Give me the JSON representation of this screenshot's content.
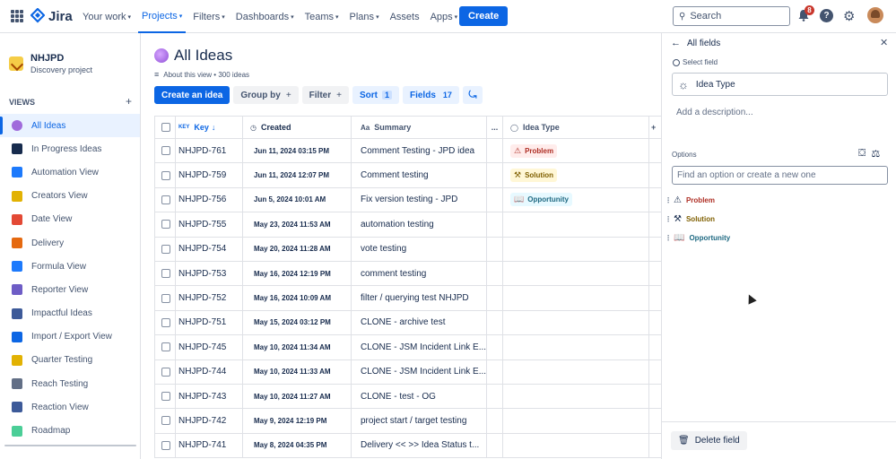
{
  "topnav": {
    "logo": "Jira",
    "items": [
      {
        "label": "Your work"
      },
      {
        "label": "Projects",
        "active": true
      },
      {
        "label": "Filters"
      },
      {
        "label": "Dashboards"
      },
      {
        "label": "Teams"
      },
      {
        "label": "Plans"
      },
      {
        "label": "Assets"
      },
      {
        "label": "Apps"
      }
    ],
    "create_label": "Create",
    "search_placeholder": "Search",
    "notifications_count": "8"
  },
  "sidebar": {
    "project_name": "NHJPD",
    "project_type": "Discovery project",
    "views_heading": "VIEWS",
    "views": [
      {
        "label": "All Ideas",
        "icon": "idea-globe-icon",
        "color": "#a06bdb"
      },
      {
        "label": "In Progress Ideas",
        "icon": "soon-icon",
        "color": "#172b4d"
      },
      {
        "label": "Automation View",
        "icon": "loop-icon",
        "color": "#1d7afc"
      },
      {
        "label": "Creators View",
        "icon": "creator-icon",
        "color": "#e2b203"
      },
      {
        "label": "Date View",
        "icon": "calendar-icon",
        "color": "#e34935"
      },
      {
        "label": "Delivery",
        "icon": "truck-icon",
        "color": "#e56910"
      },
      {
        "label": "Formula View",
        "icon": "formula-icon",
        "color": "#1d7afc"
      },
      {
        "label": "Reporter View",
        "icon": "pen-icon",
        "color": "#6e5dc6"
      },
      {
        "label": "Impactful Ideas",
        "icon": "bar-chart-icon",
        "color": "#3d5a99"
      },
      {
        "label": "Import / Export View",
        "icon": "arrows-icon",
        "color": "#0c66e4"
      },
      {
        "label": "Quarter Testing",
        "icon": "runner-icon",
        "color": "#e2b203"
      },
      {
        "label": "Reach Testing",
        "icon": "reach-icon",
        "color": "#626f86"
      },
      {
        "label": "Reaction View",
        "icon": "reaction-icon",
        "color": "#3d5a99"
      },
      {
        "label": "Roadmap",
        "icon": "map-icon",
        "color": "#4bce97"
      }
    ]
  },
  "main": {
    "title": "All Ideas",
    "about": "About this view",
    "ideas_count": "300 ideas",
    "toolbar": {
      "create_idea": "Create an idea",
      "group_by": "Group by",
      "filter": "Filter",
      "sort": "Sort",
      "sort_count": "1",
      "fields": "Fields",
      "fields_count": "17"
    },
    "columns": {
      "key": "Key",
      "created": "Created",
      "summary": "Summary",
      "dots": "...",
      "type": "Idea Type"
    },
    "rows": [
      {
        "key": "NHJPD-761",
        "created": "Jun 11, 2024 03:15 PM",
        "summary": "Comment Testing - JPD idea",
        "type": "Problem"
      },
      {
        "key": "NHJPD-759",
        "created": "Jun 11, 2024 12:07 PM",
        "summary": "Comment testing",
        "type": "Solution"
      },
      {
        "key": "NHJPD-756",
        "created": "Jun 5, 2024 10:01 AM",
        "summary": "Fix version testing - JPD",
        "type": "Opportunity"
      },
      {
        "key": "NHJPD-755",
        "created": "May 23, 2024 11:53 AM",
        "summary": "automation testing",
        "type": ""
      },
      {
        "key": "NHJPD-754",
        "created": "May 20, 2024 11:28 AM",
        "summary": "vote testing",
        "type": ""
      },
      {
        "key": "NHJPD-753",
        "created": "May 16, 2024 12:19 PM",
        "summary": "comment testing",
        "type": ""
      },
      {
        "key": "NHJPD-752",
        "created": "May 16, 2024 10:09 AM",
        "summary": "filter / querying test NHJPD",
        "type": ""
      },
      {
        "key": "NHJPD-751",
        "created": "May 15, 2024 03:12 PM",
        "summary": "CLONE - archive test",
        "type": ""
      },
      {
        "key": "NHJPD-745",
        "created": "May 10, 2024 11:34 AM",
        "summary": "CLONE - JSM Incident Link E...",
        "type": ""
      },
      {
        "key": "NHJPD-744",
        "created": "May 10, 2024 11:33 AM",
        "summary": "CLONE - JSM Incident Link E...",
        "type": ""
      },
      {
        "key": "NHJPD-743",
        "created": "May 10, 2024 11:27 AM",
        "summary": "CLONE - test - OG",
        "type": ""
      },
      {
        "key": "NHJPD-742",
        "created": "May 9, 2024 12:19 PM",
        "summary": "project start / target testing",
        "type": ""
      },
      {
        "key": "NHJPD-741",
        "created": "May 8, 2024 04:35 PM",
        "summary": "Delivery << >> Idea Status t...",
        "type": ""
      }
    ]
  },
  "panel": {
    "back_label": "All fields",
    "select_label": "Select field",
    "field_name": "Idea Type",
    "description_placeholder": "Add a description...",
    "options_label": "Options",
    "option_input_placeholder": "Find an option or create a new one",
    "options": [
      {
        "label": "Problem",
        "icon": "warning-icon",
        "color": "#ae2e24",
        "bg": "#ffeceb"
      },
      {
        "label": "Solution",
        "icon": "wrench-icon",
        "color": "#7f5f01",
        "bg": "#fff7d6"
      },
      {
        "label": "Opportunity",
        "icon": "book-icon",
        "color": "#206a83",
        "bg": "#e7f9ff"
      }
    ],
    "delete_label": "Delete field"
  },
  "colors": {
    "brand": "#0c66e4",
    "problem": "#ae2e24",
    "solution": "#7f5f01",
    "opportunity": "#206a83"
  }
}
